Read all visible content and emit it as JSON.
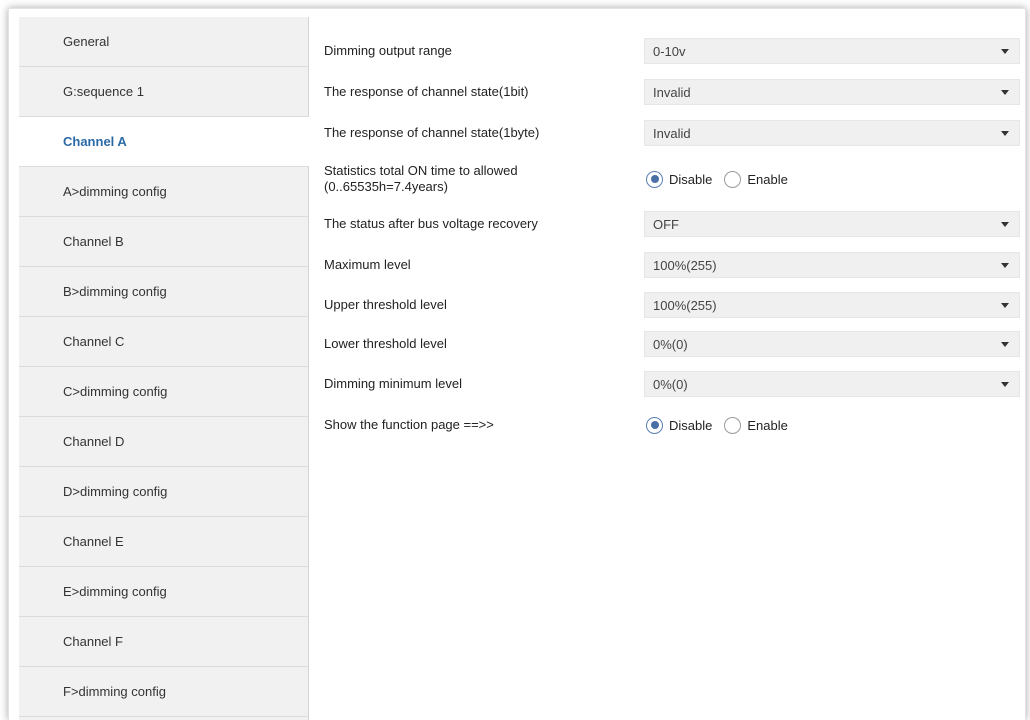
{
  "sidebar": {
    "items": [
      {
        "label": "General"
      },
      {
        "label": "G:sequence 1"
      },
      {
        "label": "Channel A"
      },
      {
        "label": "A>dimming config"
      },
      {
        "label": "Channel B"
      },
      {
        "label": "B>dimming config"
      },
      {
        "label": "Channel C"
      },
      {
        "label": "C>dimming config"
      },
      {
        "label": "Channel D"
      },
      {
        "label": "D>dimming config"
      },
      {
        "label": "Channel E"
      },
      {
        "label": "E>dimming config"
      },
      {
        "label": "Channel F"
      },
      {
        "label": "F>dimming config"
      }
    ],
    "active_item": "Channel A"
  },
  "params": {
    "dimming_output_range": {
      "label": "Dimming output range",
      "value": "0-10v"
    },
    "response_1bit": {
      "label": "The response of channel state(1bit)",
      "value": "Invalid"
    },
    "response_1byte": {
      "label": "The response of channel state(1byte)",
      "value": "Invalid"
    },
    "statistics_on_time": {
      "label_line1": "Statistics total ON time to allowed",
      "label_line2": "(0..65535h=7.4years)",
      "options": [
        "Disable",
        "Enable"
      ],
      "selected": "Disable"
    },
    "status_after_recovery": {
      "label": "The status after bus voltage recovery",
      "value": "OFF"
    },
    "maximum_level": {
      "label": "Maximum level",
      "value": "100%(255)"
    },
    "upper_threshold": {
      "label": "Upper threshold level",
      "value": "100%(255)"
    },
    "lower_threshold": {
      "label": "Lower threshold level",
      "value": "0%(0)"
    },
    "dimming_minimum": {
      "label": "Dimming minimum level",
      "value": "0%(0)"
    },
    "show_function_page": {
      "label": "Show the function page ==>>",
      "options": [
        "Disable",
        "Enable"
      ],
      "selected": "Disable"
    }
  },
  "colors": {
    "active_nav_text": "#2c6aa6",
    "sidebar_bg": "#f1f1f1",
    "select_bg": "#f0f0f0",
    "radio_dot": "#4a6fa5"
  }
}
